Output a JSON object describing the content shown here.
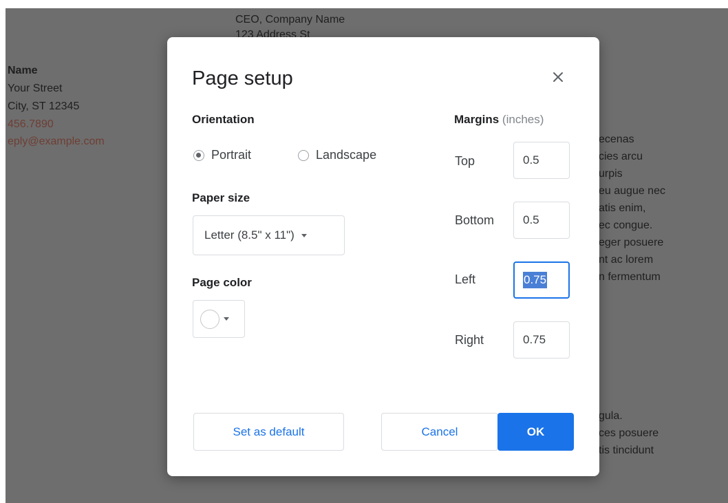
{
  "background_doc": {
    "recipient_title": "CEO, Company Name",
    "recipient_address": "123 Address St",
    "sender_name": "Name",
    "sender_street": "Your Street",
    "sender_city": "City, ST 12345",
    "sender_phone": "456.7890",
    "sender_email": "eply@example.com",
    "body_right": [
      "ecenas",
      "cies arcu",
      "urpis",
      "eu augue nec",
      "atis enim,",
      "ec congue.",
      "eger posuere",
      "nt ac lorem",
      "n fermentum"
    ],
    "body_right_2": [
      "gula.",
      "ces posuere",
      "tis tincidunt"
    ]
  },
  "dialog": {
    "title": "Page setup",
    "close_icon": "close-icon",
    "orientation": {
      "label": "Orientation",
      "options": [
        "Portrait",
        "Landscape"
      ],
      "selected": "Portrait"
    },
    "paper_size": {
      "label": "Paper size",
      "value": "Letter (8.5\" x 11\")"
    },
    "page_color": {
      "label": "Page color",
      "value": "#ffffff"
    },
    "margins": {
      "label": "Margins",
      "unit": "(inches)",
      "top_label": "Top",
      "top_value": "0.5",
      "bottom_label": "Bottom",
      "bottom_value": "0.5",
      "left_label": "Left",
      "left_value": "0.75",
      "right_label": "Right",
      "right_value": "0.75"
    },
    "buttons": {
      "set_default": "Set as default",
      "cancel": "Cancel",
      "ok": "OK"
    }
  },
  "colors": {
    "accent": "#1a73e8",
    "overlay": "#6e6e6e"
  }
}
